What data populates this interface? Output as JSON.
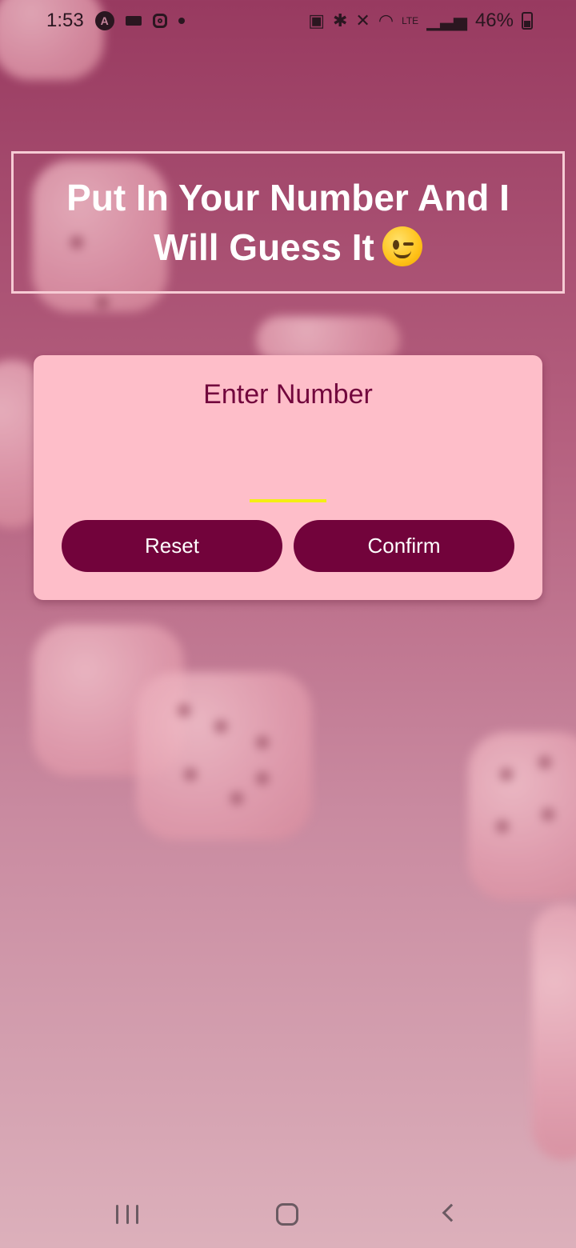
{
  "status_bar": {
    "time": "1:53",
    "battery_percent": "46%",
    "left_icons": [
      "app-a-icon",
      "video-icon",
      "instagram-icon",
      "notification-dot-icon"
    ],
    "right_icons": [
      "data-saver-icon",
      "bluetooth-icon",
      "mute-icon",
      "wifi-icon",
      "volte-icon",
      "signal-icon",
      "battery-icon"
    ]
  },
  "header": {
    "title": "Put In Your Number And I Will Guess It"
  },
  "card": {
    "title": "Enter Number",
    "input_value": "",
    "reset_label": "Reset",
    "confirm_label": "Confirm"
  },
  "colors": {
    "accent_button": "#72033b",
    "card_background": "#febec9",
    "input_underline": "#f4ee14",
    "title_text": "#ffffff"
  },
  "nav_bar": {
    "icons": [
      "recent-apps-icon",
      "home-icon",
      "back-icon"
    ]
  }
}
